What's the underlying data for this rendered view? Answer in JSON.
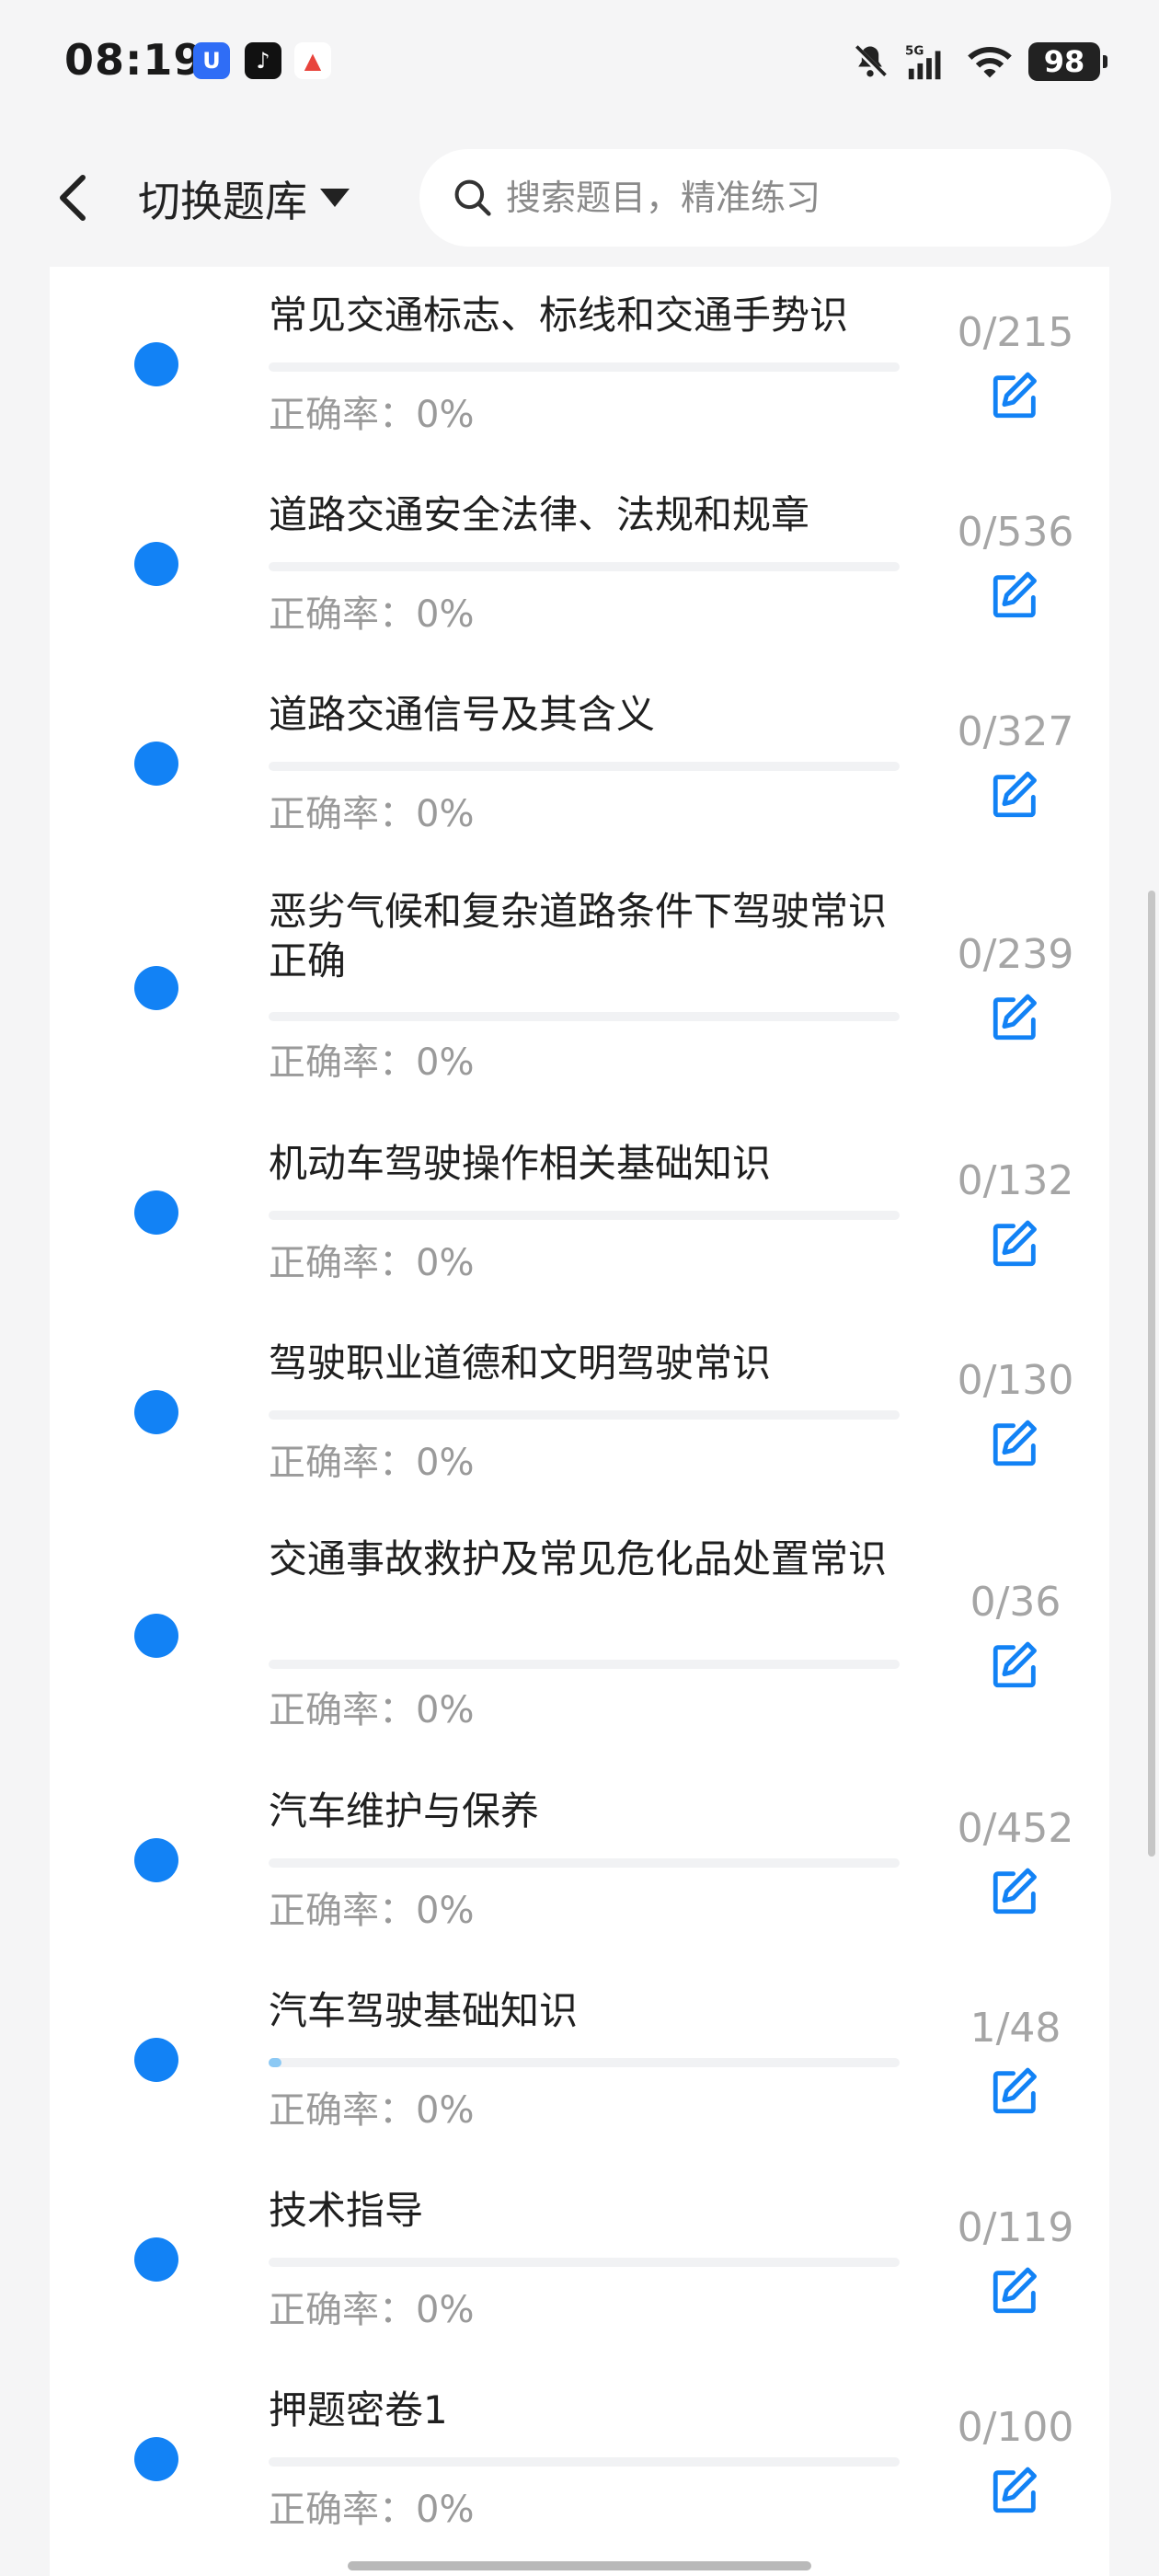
{
  "status_bar": {
    "time": "08:19",
    "apps": [
      {
        "icon": "shield-app-icon",
        "glyph": "U"
      },
      {
        "icon": "tiktok-app-icon",
        "glyph": "♪"
      },
      {
        "icon": "triangle-app-icon",
        "glyph": "▲"
      }
    ],
    "network": "5G",
    "battery": "98"
  },
  "header": {
    "bank_switch_label": "切换题库",
    "search_placeholder": "搜索题目，精准练习"
  },
  "categories": [
    {
      "title": "常见交通标志、标线和交通手势识",
      "accuracy": "正确率：0%",
      "count": "0/215",
      "progress": 0
    },
    {
      "title": "道路交通安全法律、法规和规章",
      "accuracy": "正确率：0%",
      "count": "0/536",
      "progress": 0
    },
    {
      "title": "道路交通信号及其含义",
      "accuracy": "正确率：0%",
      "count": "0/327",
      "progress": 0
    },
    {
      "title": "恶劣气候和复杂道路条件下驾驶常识正确",
      "accuracy": "正确率：0%",
      "count": "0/239",
      "progress": 0
    },
    {
      "title": "机动车驾驶操作相关基础知识",
      "accuracy": "正确率：0%",
      "count": "0/132",
      "progress": 0
    },
    {
      "title": "驾驶职业道德和文明驾驶常识",
      "accuracy": "正确率：0%",
      "count": "0/130",
      "progress": 0
    },
    {
      "title": "交通事故救护及常见危化品处置常识",
      "accuracy": "正确率：0%",
      "count": "0/36",
      "progress": 0
    },
    {
      "title": "汽车维护与保养",
      "accuracy": "正确率：0%",
      "count": "0/452",
      "progress": 0
    },
    {
      "title": "汽车驾驶基础知识",
      "accuracy": "正确率：0%",
      "count": "1/48",
      "progress": 0.0208
    },
    {
      "title": "技术指导",
      "accuracy": "正确率：0%",
      "count": "0/119",
      "progress": 0
    },
    {
      "title": "押题密卷1",
      "accuracy": "正确率：0%",
      "count": "0/100",
      "progress": 0
    }
  ],
  "colors": {
    "accent": "#1282f5",
    "progress_fill": "#8cc9f4",
    "muted_text": "#9a9a9a"
  }
}
